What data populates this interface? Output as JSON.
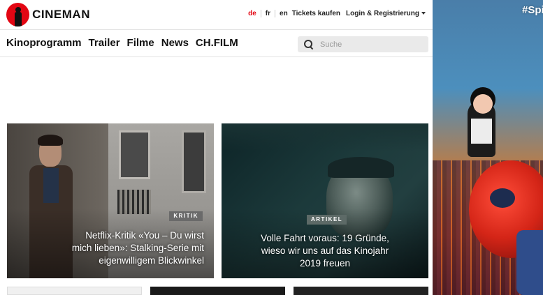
{
  "brand": {
    "logo_text": "CINEMAN"
  },
  "header": {
    "languages": [
      {
        "label": "de",
        "active": true
      },
      {
        "label": "fr",
        "active": false
      },
      {
        "label": "en",
        "active": false
      }
    ],
    "tickets_label": "Tickets kaufen",
    "login_label": "Login & Registrierung"
  },
  "nav": {
    "items": [
      "Kinoprogramm",
      "Trailer",
      "Filme",
      "News",
      "CH.FILM"
    ]
  },
  "search": {
    "placeholder": "Suche"
  },
  "articles": [
    {
      "badge": "KRITIK",
      "title": "Netflix-Kritik «You – Du wirst mich lieben»: Stalking-Serie mit eigenwilligem Blickwinkel"
    },
    {
      "badge": "ARTIKEL",
      "title": "Volle Fahrt voraus: 19 Gründe, wieso wir uns auf das Kinojahr 2019 freuen"
    }
  ],
  "side_ad": {
    "tag": "#Spi"
  },
  "colors": {
    "brand_red": "#e30613",
    "text": "#111111",
    "search_bg": "#eaeaea"
  }
}
